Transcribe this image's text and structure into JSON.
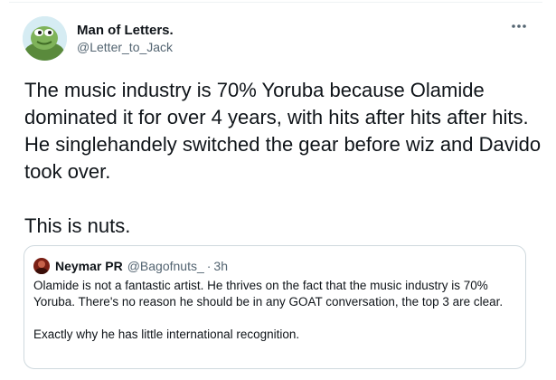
{
  "tweet": {
    "author": {
      "display_name": "Man of Letters.",
      "handle": "@Letter_to_Jack",
      "avatar_icon": "frog-avatar-icon"
    },
    "more_icon": "more-options-icon",
    "text_paragraph_1": "The music industry is 70% Yoruba because Olamide dominated it for over 4 years, with hits after hits after hits. He singlehandely switched the gear before wiz and Davido took over.",
    "text_paragraph_2": "This is nuts."
  },
  "quoted_tweet": {
    "author": {
      "display_name": "Neymar PR",
      "handle": "@Bagofnuts_",
      "separator": "·",
      "time": "3h",
      "avatar_icon": "user-avatar-icon"
    },
    "text_paragraph_1": "Olamide is not a fantastic artist. He thrives on the fact that the music industry is 70% Yoruba. There's no reason he should be in any GOAT conversation, the top 3 are clear.",
    "text_paragraph_2": "Exactly why he has little international recognition."
  },
  "colors": {
    "text_primary": "#0f1419",
    "text_secondary": "#536471",
    "border": "#cfd9de"
  }
}
